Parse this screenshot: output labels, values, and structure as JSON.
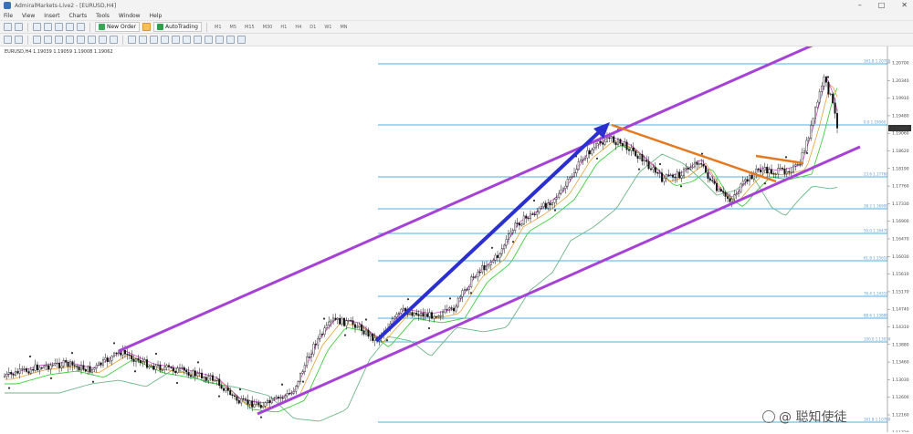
{
  "window": {
    "title": "AdmiralMarkets-Live2 - [EURUSD,H4]",
    "controls": [
      "–",
      "□",
      "✕"
    ]
  },
  "menu": [
    "File",
    "View",
    "Insert",
    "Charts",
    "Tools",
    "Window",
    "Help"
  ],
  "toolbar": {
    "new_order": "New Order",
    "auto_trading": "AutoTrading",
    "timeframes": [
      "M1",
      "M5",
      "M15",
      "M30",
      "H1",
      "H4",
      "D1",
      "W1",
      "MN"
    ]
  },
  "chart": {
    "symbol_info": "EURUSD,H4  1.19039 1.19059 1.19008 1.19062",
    "prices": [
      "1.20700",
      "1.20340",
      "1.19910",
      "1.19480",
      "1.19060",
      "1.18620",
      "1.18190",
      "1.17760",
      "1.17330",
      "1.16900",
      "1.16470",
      "1.16030",
      "1.15610",
      "1.15170",
      "1.14740",
      "1.14310",
      "1.13880",
      "1.13460",
      "1.13030",
      "1.12600",
      "1.12160",
      "1.11720"
    ],
    "current_price": "1.19060",
    "fib_levels": [
      "161.8  1.20700",
      "0.0  1.19060",
      "23.6  1.17760",
      "38.2  1.16900",
      "50.0  1.16470",
      "61.8  1.15610",
      "76.4  1.14310",
      "88.6  1.13880",
      "100.0  1.13030",
      "161.8  1.10780"
    ],
    "colors": {
      "channel": "#a641d6",
      "trend_arrow": "#2b2fd0",
      "triangle": "#e5791f",
      "fib": "#49b3df",
      "candle": "#111111",
      "ma_fast": "#d44fd2",
      "ma_mid": "#e8a03a",
      "ma_green": "#3fcf3f",
      "ma_slow": "#6fb58a"
    }
  },
  "watermark": "@ 聪知使徒"
}
